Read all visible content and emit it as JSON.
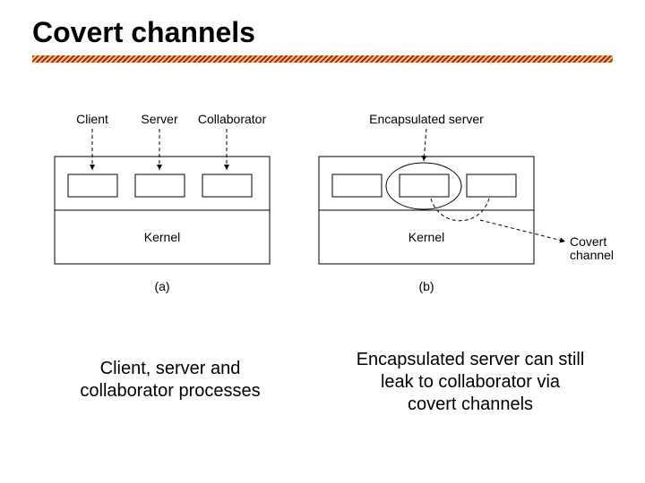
{
  "title": "Covert channels",
  "left": {
    "lbl_client": "Client",
    "lbl_server": "Server",
    "lbl_collab": "Collaborator",
    "kernel": "Kernel",
    "tag": "(a)",
    "caption": "Client, server and collaborator processes"
  },
  "right": {
    "lbl_encap": "Encapsulated server",
    "kernel": "Kernel",
    "tag": "(b)",
    "covert_label_1": "Covert",
    "covert_label_2": "channel",
    "caption_l1": "Encapsulated server can still",
    "caption_l2": "leak to collaborator via",
    "caption_l3": "covert channels"
  }
}
